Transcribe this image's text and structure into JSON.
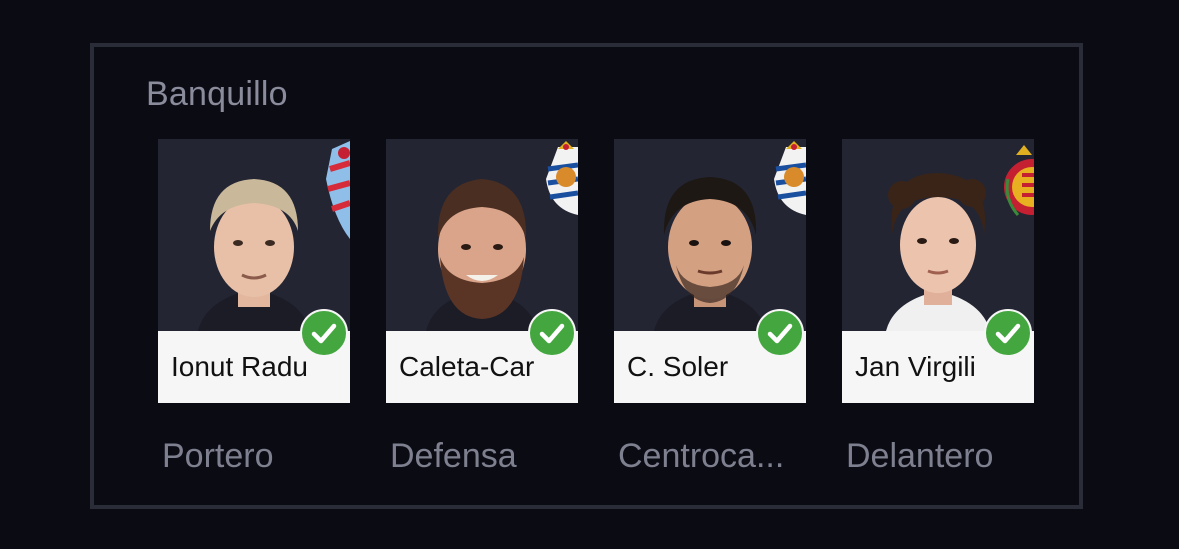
{
  "bench": {
    "title": "Banquillo",
    "players": [
      {
        "name": "Ionut Radu",
        "position": "Portero",
        "selected": true,
        "club_crest_icon": "celta-crest-icon"
      },
      {
        "name": "Caleta-Car",
        "position": "Defensa",
        "selected": true,
        "club_crest_icon": "real-sociedad-crest-icon"
      },
      {
        "name": "C. Soler",
        "position": "Centroca...",
        "selected": true,
        "club_crest_icon": "real-sociedad-crest-icon"
      },
      {
        "name": "Jan Virgili",
        "position": "Delantero",
        "selected": true,
        "club_crest_icon": "mallorca-crest-icon"
      }
    ]
  },
  "colors": {
    "background": "#0b0b14",
    "panel_border": "#2a2c38",
    "card_photo_bg": "#232533",
    "check_green": "#43a63f",
    "label_gray": "#7e8090"
  }
}
